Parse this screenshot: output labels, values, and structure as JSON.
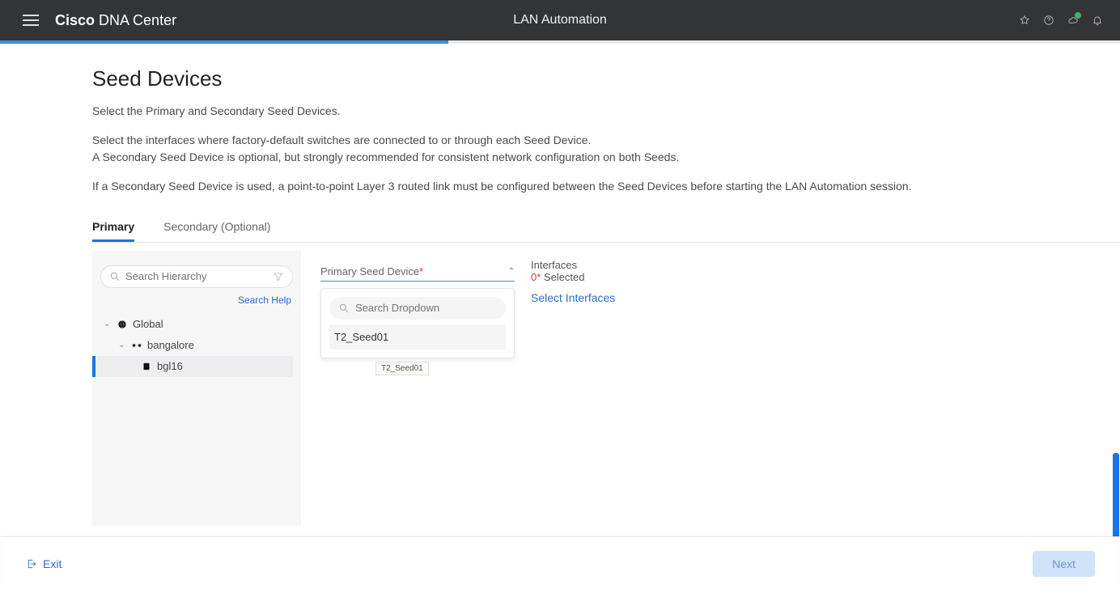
{
  "header": {
    "brand_bold": "Cisco",
    "brand_rest": " DNA Center",
    "title": "LAN Automation"
  },
  "page": {
    "heading": "Seed Devices",
    "desc1": "Select the Primary and Secondary Seed Devices.",
    "desc2": "Select the interfaces where factory-default switches are connected to or through each Seed Device.\nA Secondary Seed Device is optional, but strongly recommended for consistent network configuration on both Seeds.",
    "desc3": "If a Secondary Seed Device is used, a point-to-point Layer 3 routed link must be configured between the Seed Devices before starting the LAN Automation session."
  },
  "tabs": {
    "primary": "Primary",
    "secondary": "Secondary (Optional)"
  },
  "hierarchy": {
    "search_placeholder": "Search Hierarchy",
    "search_help": "Search Help",
    "nodes": {
      "global": "Global",
      "bangalore": "bangalore",
      "bgl16": "bgl16"
    }
  },
  "dropdown": {
    "label": "Primary Seed Device",
    "required_mark": "*",
    "search_placeholder": "Search Dropdown",
    "option1": "T2_Seed01",
    "tooltip": "T2_Seed01"
  },
  "interfaces": {
    "title": "Interfaces",
    "count_zero": "0",
    "count_star": "*",
    "count_suffix": " Selected",
    "link": "Select Interfaces"
  },
  "footer": {
    "exit": "Exit",
    "next": "Next"
  }
}
